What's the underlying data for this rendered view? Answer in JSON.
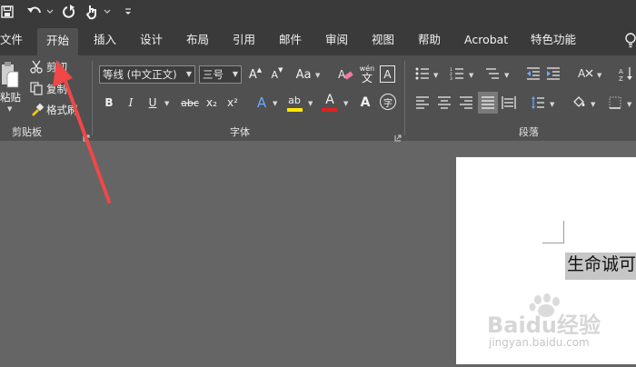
{
  "menu_tabs": [
    {
      "label": "文件"
    },
    {
      "label": "开始"
    },
    {
      "label": "插入"
    },
    {
      "label": "设计"
    },
    {
      "label": "布局"
    },
    {
      "label": "引用"
    },
    {
      "label": "邮件"
    },
    {
      "label": "审阅"
    },
    {
      "label": "视图"
    },
    {
      "label": "帮助"
    },
    {
      "label": "Acrobat"
    },
    {
      "label": "特色功能"
    }
  ],
  "active_tab": "开始",
  "clipboard": {
    "paste_label": "粘贴",
    "cut_label": "剪切",
    "copy_label": "复制",
    "format_painter_label": "格式刷",
    "group_label": "剪贴板"
  },
  "font": {
    "font_name": "等线 (中文正文)",
    "font_size": "三号",
    "group_label": "字体",
    "bold": "B",
    "italic": "I",
    "underline": "U",
    "strike": "abc",
    "sub": "x₂",
    "sup": "x²",
    "grow": "A",
    "shrink": "A",
    "case": "Aa",
    "phonetic": "wén",
    "phonetic_char": "文",
    "border_char": "A",
    "text_effect": "A",
    "highlight": "ab",
    "font_color": "A",
    "shading": "A",
    "enclose": "字"
  },
  "paragraph": {
    "group_label": "段落"
  },
  "document": {
    "text": "生命诚可"
  },
  "watermark": {
    "brand_text": "Baidu经验",
    "url_text": "jingyan.baidu.com"
  },
  "colors": {
    "titlebar": "#3a3a3a",
    "ribbon": "#505050",
    "canvas": "#656565",
    "highlight_yellow": "#ffe600",
    "font_red": "#e02020",
    "annotation_arrow": "#f04747"
  }
}
